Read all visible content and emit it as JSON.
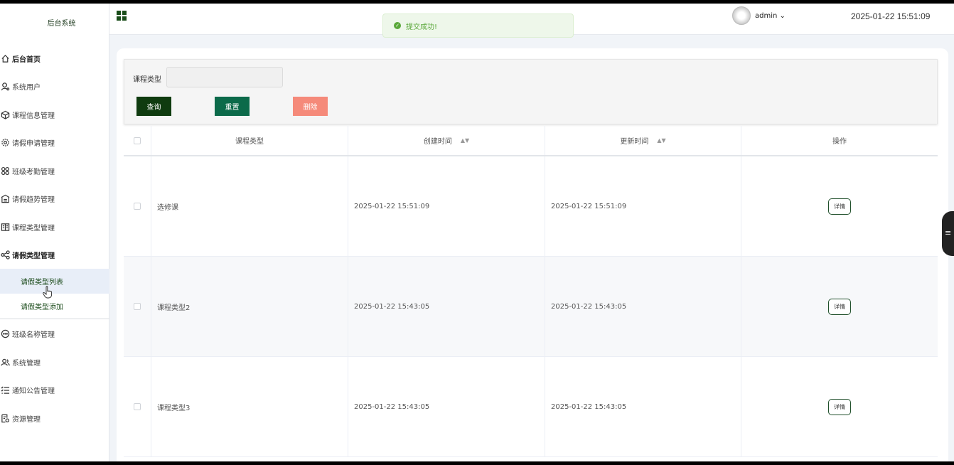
{
  "sidebar": {
    "brand": "后台系统",
    "items": [
      {
        "label": "后台首页",
        "icon": "home-icon",
        "bold": true
      },
      {
        "label": "系统用户",
        "icon": "user-icon"
      },
      {
        "label": "课程信息管理",
        "icon": "box-icon"
      },
      {
        "label": "请假申请管理",
        "icon": "gear-icon"
      },
      {
        "label": "班级考勤管理",
        "icon": "grid-icon"
      },
      {
        "label": "请假趋势管理",
        "icon": "school-icon"
      },
      {
        "label": "课程类型管理",
        "icon": "book-icon"
      },
      {
        "label": "请假类型管理",
        "icon": "share-icon",
        "bold": true
      }
    ],
    "submenu": [
      {
        "label": "请假类型列表",
        "active": true
      },
      {
        "label": "请假类型添加"
      }
    ],
    "items_after": [
      {
        "label": "班级名称管理",
        "icon": "chat-icon"
      },
      {
        "label": "系统管理",
        "icon": "users-icon"
      },
      {
        "label": "通知公告管理",
        "icon": "list-icon"
      },
      {
        "label": "资源管理",
        "icon": "file-icon"
      }
    ]
  },
  "topbar": {
    "user": "admin",
    "datetime": "2025-01-22 15:51:09"
  },
  "toast": {
    "message": "提交成功!"
  },
  "filter": {
    "label": "课程类型",
    "input_value": "",
    "query": "查询",
    "reset": "重置",
    "delete": "删除"
  },
  "table": {
    "headers": [
      "课程类型",
      "创建时间",
      "更新时间",
      "操作"
    ],
    "rows": [
      {
        "type": "选修课",
        "created": "2025-01-22 15:51:09",
        "updated": "2025-01-22 15:51:09",
        "action": "详情"
      },
      {
        "type": "课程类型2",
        "created": "2025-01-22 15:43:05",
        "updated": "2025-01-22 15:43:05",
        "action": "详情"
      },
      {
        "type": "课程类型3",
        "created": "2025-01-22 15:43:05",
        "updated": "2025-01-22 15:43:05",
        "action": "详情"
      }
    ]
  },
  "colors": {
    "query_button": "#0f3b0f",
    "reset_button": "#0c6a4a",
    "delete_button": "#f58a7a",
    "toast_text": "#5aa83a"
  }
}
